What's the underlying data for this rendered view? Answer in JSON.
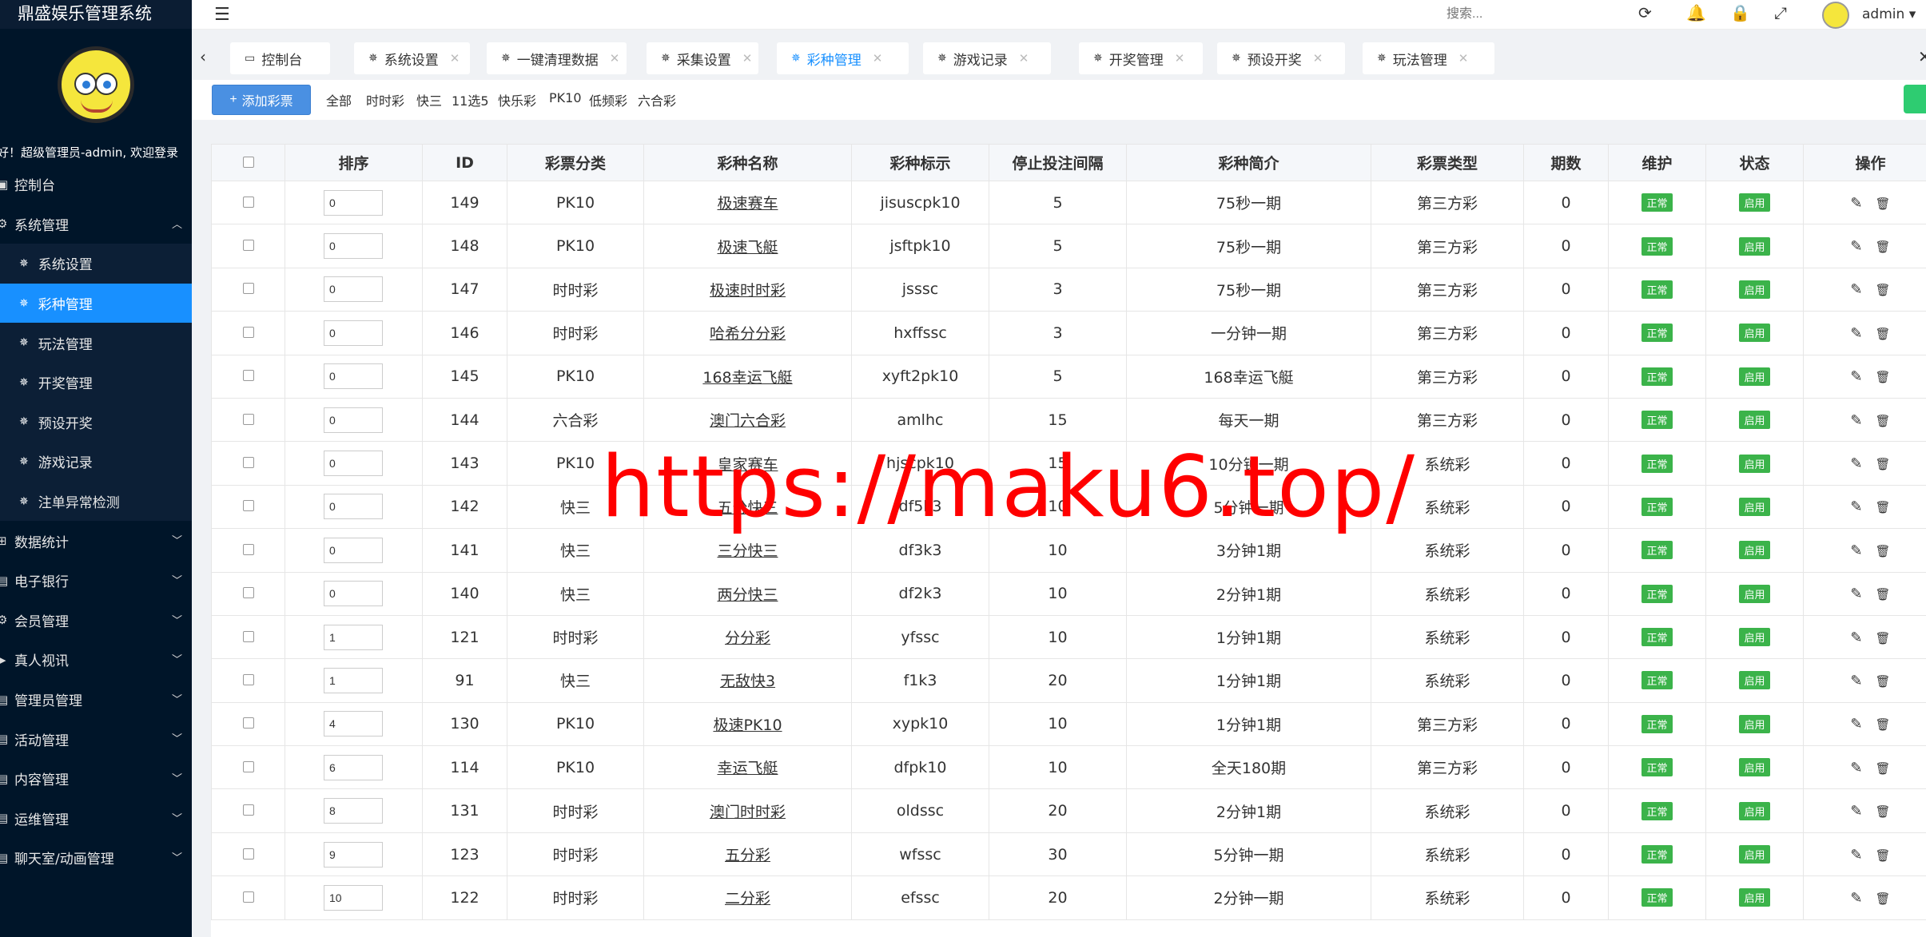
{
  "app": {
    "title": "鼎盛娱乐管理系统",
    "greeting": "好！超级管理员-admin, 欢迎登录"
  },
  "sidebar": {
    "items": [
      {
        "label": "控制台",
        "type": "top"
      },
      {
        "label": "系统管理",
        "type": "top",
        "expanded": true
      },
      {
        "label": "系统设置",
        "type": "sub"
      },
      {
        "label": "彩种管理",
        "type": "sub",
        "active": true
      },
      {
        "label": "玩法管理",
        "type": "sub"
      },
      {
        "label": "开奖管理",
        "type": "sub"
      },
      {
        "label": "预设开奖",
        "type": "sub"
      },
      {
        "label": "游戏记录",
        "type": "sub"
      },
      {
        "label": "注单异常检测",
        "type": "sub"
      },
      {
        "label": "数据统计",
        "type": "top"
      },
      {
        "label": "电子银行",
        "type": "top"
      },
      {
        "label": "会员管理",
        "type": "top"
      },
      {
        "label": "真人视讯",
        "type": "top"
      },
      {
        "label": "管理员管理",
        "type": "top"
      },
      {
        "label": "活动管理",
        "type": "top"
      },
      {
        "label": "内容管理",
        "type": "top"
      },
      {
        "label": "运维管理",
        "type": "top"
      },
      {
        "label": "聊天室/动画管理",
        "type": "top"
      }
    ]
  },
  "header": {
    "search_placeholder": "搜索...",
    "user": "admin"
  },
  "tabs": [
    {
      "label": "控制台",
      "active": false,
      "closable": false
    },
    {
      "label": "系统设置",
      "active": false,
      "closable": true
    },
    {
      "label": "一键清理数据",
      "active": false,
      "closable": true
    },
    {
      "label": "采集设置",
      "active": false,
      "closable": true
    },
    {
      "label": "彩种管理",
      "active": true,
      "closable": true
    },
    {
      "label": "游戏记录",
      "active": false,
      "closable": true
    },
    {
      "label": "开奖管理",
      "active": false,
      "closable": true
    },
    {
      "label": "预设开奖",
      "active": false,
      "closable": true
    },
    {
      "label": "玩法管理",
      "active": false,
      "closable": true
    }
  ],
  "toolbar": {
    "add_label": "添加彩票",
    "filters": [
      "全部",
      "时时彩",
      "快三",
      "11选5",
      "快乐彩",
      "PK10",
      "低频彩",
      "六合彩"
    ]
  },
  "table": {
    "columns": [
      "排序",
      "ID",
      "彩票分类",
      "彩种名称",
      "彩种标示",
      "停止投注间隔",
      "彩种简介",
      "彩票类型",
      "期数",
      "维护",
      "状态",
      "操作"
    ],
    "rows": [
      {
        "sort": "0",
        "id": "149",
        "category": "PK10",
        "name": "极速赛车",
        "code": "jisuscpk10",
        "interval": "5",
        "intro": "75秒一期",
        "type": "第三方彩",
        "issues": "0",
        "maint": "正常",
        "status": "启用"
      },
      {
        "sort": "0",
        "id": "148",
        "category": "PK10",
        "name": "极速飞艇",
        "code": "jsftpk10",
        "interval": "5",
        "intro": "75秒一期",
        "type": "第三方彩",
        "issues": "0",
        "maint": "正常",
        "status": "启用"
      },
      {
        "sort": "0",
        "id": "147",
        "category": "时时彩",
        "name": "极速时时彩",
        "code": "jsssc",
        "interval": "3",
        "intro": "75秒一期",
        "type": "第三方彩",
        "issues": "0",
        "maint": "正常",
        "status": "启用"
      },
      {
        "sort": "0",
        "id": "146",
        "category": "时时彩",
        "name": "哈希分分彩",
        "code": "hxffssc",
        "interval": "3",
        "intro": "一分钟一期",
        "type": "第三方彩",
        "issues": "0",
        "maint": "正常",
        "status": "启用"
      },
      {
        "sort": "0",
        "id": "145",
        "category": "PK10",
        "name": "168幸运飞艇",
        "code": "xyft2pk10",
        "interval": "5",
        "intro": "168幸运飞艇",
        "type": "第三方彩",
        "issues": "0",
        "maint": "正常",
        "status": "启用"
      },
      {
        "sort": "0",
        "id": "144",
        "category": "六合彩",
        "name": "澳门六合彩",
        "code": "amlhc",
        "interval": "15",
        "intro": "每天一期",
        "type": "第三方彩",
        "issues": "0",
        "maint": "正常",
        "status": "启用"
      },
      {
        "sort": "0",
        "id": "143",
        "category": "PK10",
        "name": "皇家赛车",
        "code": "hjscpk10",
        "interval": "15",
        "intro": "10分钟一期",
        "type": "系统彩",
        "issues": "0",
        "maint": "正常",
        "status": "启用"
      },
      {
        "sort": "0",
        "id": "142",
        "category": "快三",
        "name": "五分快三",
        "code": "df5k3",
        "interval": "10",
        "intro": "5分钟一期",
        "type": "系统彩",
        "issues": "0",
        "maint": "正常",
        "status": "启用"
      },
      {
        "sort": "0",
        "id": "141",
        "category": "快三",
        "name": "三分快三",
        "code": "df3k3",
        "interval": "10",
        "intro": "3分钟1期",
        "type": "系统彩",
        "issues": "0",
        "maint": "正常",
        "status": "启用"
      },
      {
        "sort": "0",
        "id": "140",
        "category": "快三",
        "name": "两分快三",
        "code": "df2k3",
        "interval": "10",
        "intro": "2分钟1期",
        "type": "系统彩",
        "issues": "0",
        "maint": "正常",
        "status": "启用"
      },
      {
        "sort": "1",
        "id": "121",
        "category": "时时彩",
        "name": "分分彩",
        "code": "yfssc",
        "interval": "10",
        "intro": "1分钟1期",
        "type": "系统彩",
        "issues": "0",
        "maint": "正常",
        "status": "启用"
      },
      {
        "sort": "1",
        "id": "91",
        "category": "快三",
        "name": "无敌快3",
        "code": "f1k3",
        "interval": "20",
        "intro": "1分钟1期",
        "type": "系统彩",
        "issues": "0",
        "maint": "正常",
        "status": "启用"
      },
      {
        "sort": "4",
        "id": "130",
        "category": "PK10",
        "name": "极速PK10",
        "code": "xypk10",
        "interval": "10",
        "intro": "1分钟1期",
        "type": "第三方彩",
        "issues": "0",
        "maint": "正常",
        "status": "启用"
      },
      {
        "sort": "6",
        "id": "114",
        "category": "PK10",
        "name": "幸运飞艇",
        "code": "dfpk10",
        "interval": "10",
        "intro": "全天180期",
        "type": "第三方彩",
        "issues": "0",
        "maint": "正常",
        "status": "启用"
      },
      {
        "sort": "8",
        "id": "131",
        "category": "时时彩",
        "name": "澳门时时彩",
        "code": "oldssc",
        "interval": "20",
        "intro": "2分钟1期",
        "type": "系统彩",
        "issues": "0",
        "maint": "正常",
        "status": "启用"
      },
      {
        "sort": "9",
        "id": "123",
        "category": "时时彩",
        "name": "五分彩",
        "code": "wfssc",
        "interval": "30",
        "intro": "5分钟一期",
        "type": "系统彩",
        "issues": "0",
        "maint": "正常",
        "status": "启用"
      },
      {
        "sort": "10",
        "id": "122",
        "category": "时时彩",
        "name": "二分彩",
        "code": "efssc",
        "interval": "20",
        "intro": "2分钟一期",
        "type": "系统彩",
        "issues": "0",
        "maint": "正常",
        "status": "启用"
      }
    ]
  },
  "watermark": "https://maku6.top/",
  "colors": {
    "sidebar_bg": "#001529",
    "active_blue": "#1890ff",
    "badge_green": "#3bb34a",
    "watermark_red": "#ff0000"
  }
}
